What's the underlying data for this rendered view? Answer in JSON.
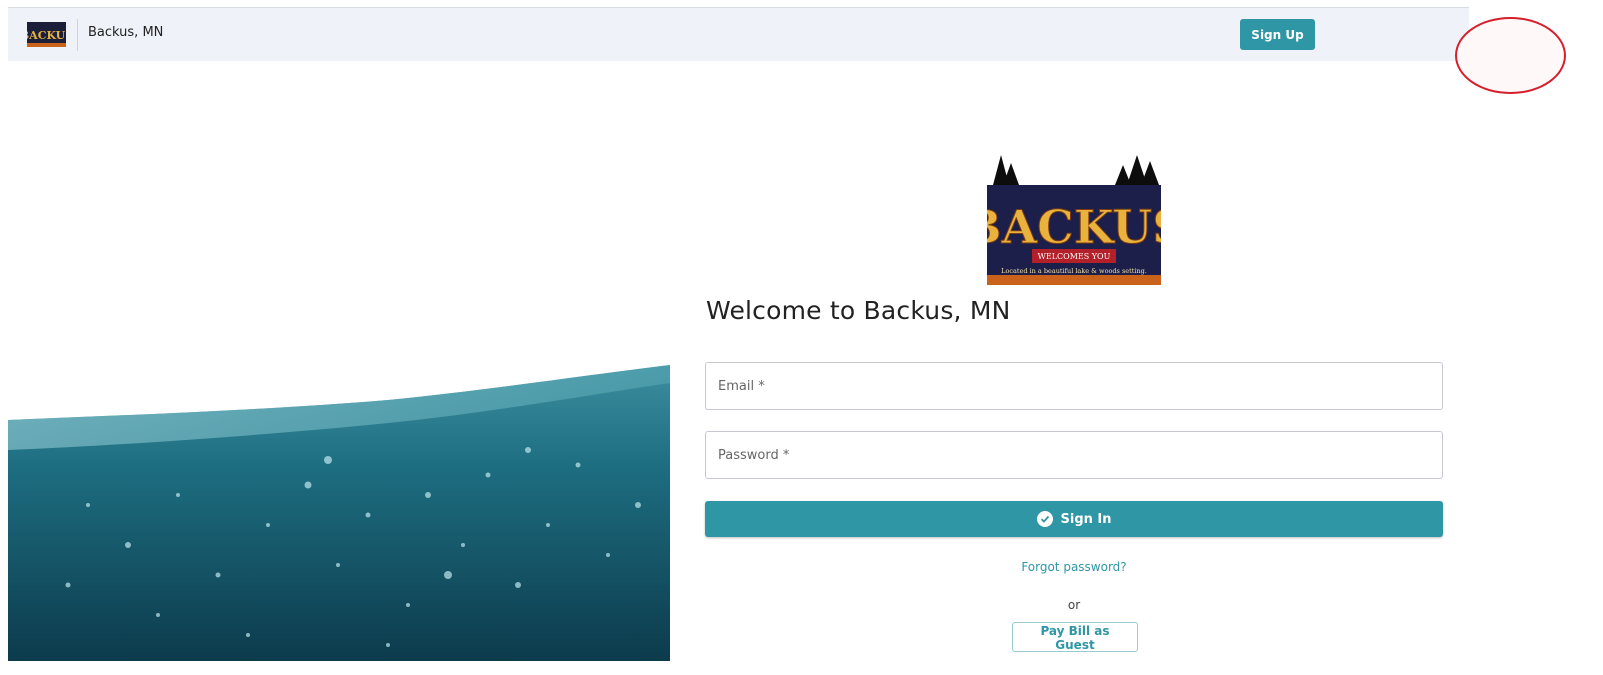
{
  "header": {
    "logo_text": "BACKUS",
    "site_name": "Backus, MN",
    "signup_label": "Sign Up"
  },
  "logo": {
    "title": "BACKUS",
    "banner": "WELCOMES YOU",
    "tagline": "Located in a beautiful lake & woods setting."
  },
  "login": {
    "title": "Welcome to Backus, MN",
    "email_placeholder": "Email *",
    "password_placeholder": "Password *",
    "signin_label": "Sign In",
    "forgot_label": "Forgot password?",
    "or_label": "or",
    "guest_label": "Pay Bill as Guest"
  },
  "colors": {
    "accent": "#2f96a6",
    "header_bg": "#eff2f8",
    "annotation_circle": "#d61f2c"
  }
}
